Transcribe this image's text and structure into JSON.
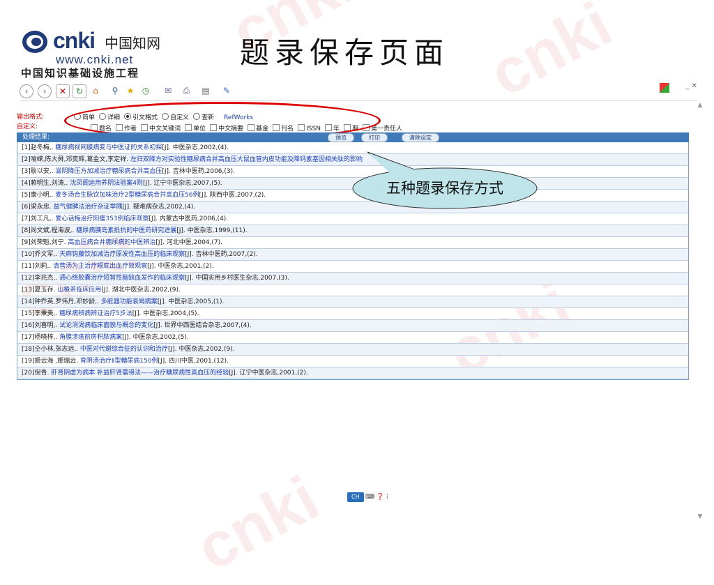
{
  "logo": {
    "brand": "cnki",
    "cn_name": "中国知网",
    "url": "www.cnki.net",
    "project": "中国知识基础设施工程"
  },
  "slide_title": "题录保存页面",
  "toolbar": {
    "icons": [
      "back-icon",
      "forward-icon",
      "stop-icon",
      "refresh-icon",
      "home-icon",
      "search-icon",
      "favorites-icon",
      "history-icon",
      "mail-icon",
      "print-icon",
      "edit-icon",
      "discuss-icon"
    ]
  },
  "window_controls": "_ ✕",
  "form": {
    "output_format_label": "输出格式:",
    "custom_label": "自定义:",
    "options": [
      {
        "label": "简单",
        "selected": false
      },
      {
        "label": "详细",
        "selected": false
      },
      {
        "label": "引文格式",
        "selected": true
      },
      {
        "label": "自定义",
        "selected": false
      },
      {
        "label": "查新",
        "selected": false
      }
    ],
    "refworks": "RefWorks",
    "custom_fields": [
      "题名",
      "作者",
      "中文关键词",
      "单位",
      "中文摘要",
      "基金",
      "刊名",
      "ISSN",
      "年",
      "期",
      "第一责任人"
    ]
  },
  "results": {
    "header_label": "处理结果:",
    "buttons": {
      "preview": "预览",
      "print": "打印",
      "clear": "清除设定"
    },
    "rows": [
      {
        "pre": "[1]赵冬梅,. ",
        "title": "糖尿病视网膜病变与中医证的关系初探",
        "post": "[J]. 中医杂志,2002,(4)."
      },
      {
        "pre": "[2]喻嵘,陈大舜,邓奕辉,葛金文,李定祥. ",
        "title": "左归双降方对实验性糖尿病合并高血压大鼠血管内皮功能及降钙素基因相关肽的影响",
        "post": ""
      },
      {
        "pre": "[3]耿以安,. ",
        "title": "滋阴降压方加减治疗糖尿病合并高血压",
        "post": "[J]. 吉林中医药,2006,(3)."
      },
      {
        "pre": "[4]赖明生,刘涛,. ",
        "title": "沈凤阁运用养阴法验案4则",
        "post": "[J]. 辽宁中医杂志,2007,(5)."
      },
      {
        "pre": "[5]康小明,. ",
        "title": "麦冬汤合生脉饮加味治疗2型糖尿病合并高血压56例",
        "post": "[J]. 陕西中医,2007,(2)."
      },
      {
        "pre": "[6]梁永忠. ",
        "title": "益气健脾法治疗杂证举隅",
        "post": "[J]. 疑难病杂志,2002,(4)."
      },
      {
        "pre": "[7]刘工凡,. ",
        "title": "爱心话梅治疗阳痿353例临床观察",
        "post": "[J]. 内蒙古中医药,2006,(4)."
      },
      {
        "pre": "[8]尚文斌,程海波,. ",
        "title": "糖尿病胰岛素抵抗的中医药研究进展",
        "post": "[J]. 中医杂志,1999,(11)."
      },
      {
        "pre": "[9]刘荣魁,刘宁. ",
        "title": "高血压病合并糖尿病的中医辨治",
        "post": "[J]. 河北中医,2004,(7)."
      },
      {
        "pre": "[10]乔文军,. ",
        "title": "天麻钩藤饮加减治疗原发性高血压的临床观察",
        "post": "[J]. 吉林中医药,2007,(2)."
      },
      {
        "pre": "[11]刘莉,. ",
        "title": "清营汤为主治疗眼底出血疗效观察",
        "post": "[J]. 中医杂志,2001,(2)."
      },
      {
        "pre": "[12]李兆杰,. ",
        "title": "通心络胶囊治疗短暂性脑缺血发作的临床观察",
        "post": "[J]. 中国实用乡村医生杂志,2007,(3)."
      },
      {
        "pre": "[13]夏玉存. ",
        "title": "山楂茶临床应用",
        "post": "[J]. 湖北中医杂志,2002,(9)."
      },
      {
        "pre": "[14]钟乔英,罗伟丹,邓妙龄,. ",
        "title": "多脏器功能衰竭病案",
        "post": "[J]. 中医杂志,2005,(1)."
      },
      {
        "pre": "[15]李秉美,. ",
        "title": "糖尿病辨病辨证治疗5步法",
        "post": "[J]. 中医杂志,2004,(5)."
      },
      {
        "pre": "[16]刘喜明,. ",
        "title": "试论消渴病临床面貌与概念的变化",
        "post": "[J]. 世界中西医结合杂志,2007,(4)."
      },
      {
        "pre": "[17]杨晓梓,. ",
        "title": "角膜溃疡前房积脓病案",
        "post": "[J]. 中医杂志,2002,(5)."
      },
      {
        "pre": "[18]仝小林,张志远,. ",
        "title": "中医对代谢综合征的认识和治疗",
        "post": "[J]. 中医杂志,2002,(9)."
      },
      {
        "pre": "[19]姬云海 ,姬瑞云. ",
        "title": "育阴汤治疗Ⅱ型糖尿病150例",
        "post": "[J]. 四川中医,2001,(12)."
      },
      {
        "pre": "[20]倪青. ",
        "title": "肝肾阴虚为病本 补益肝肾需得法——治疗糖尿病性高血压的经验",
        "post": "[J]. 辽宁中医杂志,2001,(2)."
      }
    ]
  },
  "callout": "五种题录保存方式",
  "ime": {
    "label": "CH"
  },
  "colors": {
    "accent": "#3f79b8",
    "link": "#1a3fb8",
    "highlight": "#d00000",
    "callout_fill": "#bfe5ea"
  }
}
